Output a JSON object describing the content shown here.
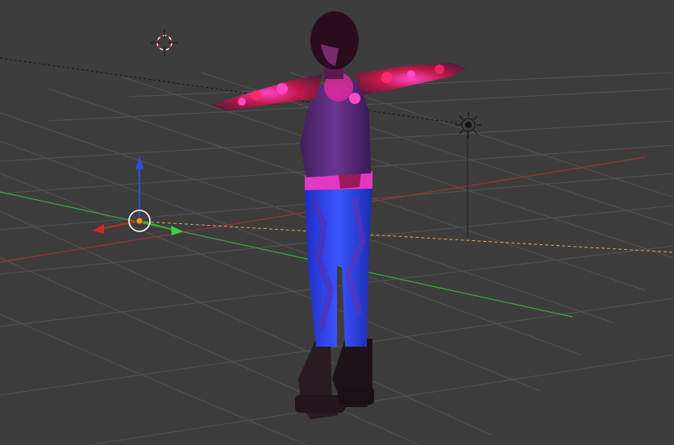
{
  "viewport": {
    "background_color": "#3d3d3d",
    "grid_color": "#4f4f4f",
    "x_axis_color": "#b03030",
    "y_axis_color": "#3fae3f",
    "z_axis_color": "#2d4dd6",
    "dashed_guide_color": "#151515",
    "orange_guide_color": "#e0a060"
  },
  "scene": {
    "objects": [
      {
        "name": "character-figure",
        "icon": "human-figure"
      },
      {
        "name": "3d-cursor",
        "icon": "crosshair-icon"
      },
      {
        "name": "lamp",
        "icon": "sun-lamp-icon"
      },
      {
        "name": "transform-manipulator",
        "icon": "move-gizmo-icon"
      }
    ]
  },
  "character": {
    "shirt_color": "#5a2d78",
    "sleeve_pattern_colors": [
      "#ff2fb8",
      "#d81a3a",
      "#8a1c4e"
    ],
    "jeans_color": "#2b3fd8",
    "boot_color": "#2a1a22",
    "hair_color": "#2a0c1c",
    "skin_color": "#7a2870",
    "belt_color": "#e13ac0"
  }
}
